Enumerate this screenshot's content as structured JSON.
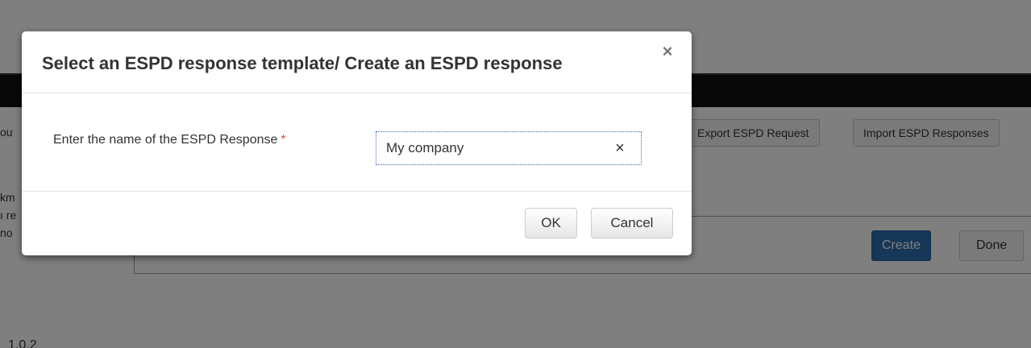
{
  "background": {
    "buttons": {
      "export_request": "Export ESPD Request",
      "import_responses": "Import ESPD Responses",
      "create": "Create",
      "done": "Done"
    },
    "fragments": [
      "ou",
      "km",
      "ı re",
      "no"
    ],
    "version": "1.0.2"
  },
  "modal": {
    "title": "Select an ESPD response template/ Create an ESPD response",
    "close_glyph": "×",
    "field": {
      "label": "Enter the name of the ESPD Response",
      "required_marker": "*",
      "value": "My company",
      "clear_glyph": "×"
    },
    "footer": {
      "ok_label": "OK",
      "cancel_label": "Cancel"
    }
  },
  "colors": {
    "overlay": "#000000",
    "primary_button": "#2f6fb0",
    "required": "#d9534f"
  }
}
